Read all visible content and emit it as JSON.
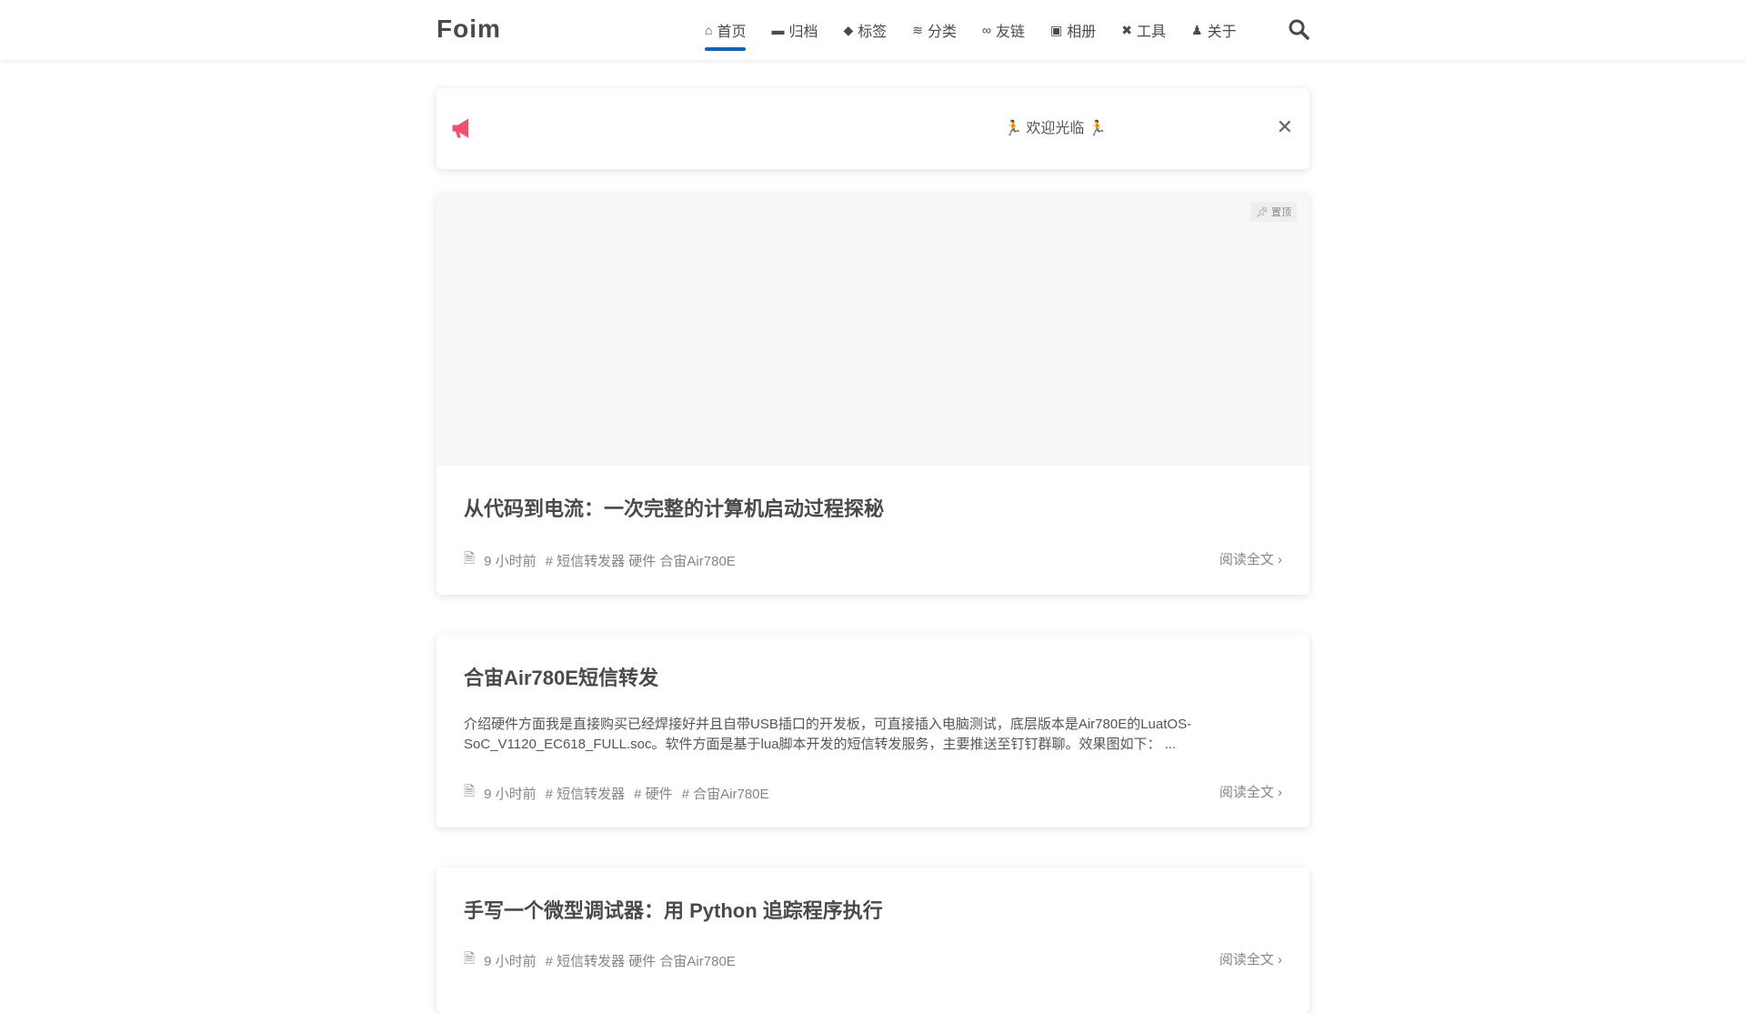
{
  "header": {
    "logo": "Foim",
    "nav": [
      {
        "label": "首页",
        "icon": "home-icon"
      },
      {
        "label": "归档",
        "icon": "archive-icon"
      },
      {
        "label": "标签",
        "icon": "tags-icon"
      },
      {
        "label": "分类",
        "icon": "layers-icon"
      },
      {
        "label": "友链",
        "icon": "link-icon"
      },
      {
        "label": "相册",
        "icon": "image-icon"
      },
      {
        "label": "工具",
        "icon": "tools-icon"
      },
      {
        "label": "关于",
        "icon": "user-graduate-icon"
      }
    ],
    "active": "首页"
  },
  "notice": {
    "message": "🏃 欢迎光临 🏃",
    "close": "✕"
  },
  "colors": {
    "accent": "#0a66c2",
    "megaphone": "#f0506e"
  },
  "posts": [
    {
      "title": "从代码到电流：一次完整的计算机启动过程探秘",
      "pinned": "置顶",
      "time": "9 小时前",
      "tags": "# 短信转发器 硬件 合宙Air780E",
      "more": "阅读全文"
    },
    {
      "title": "合宙Air780E短信转发",
      "excerpt": "介绍硬件方面我是直接购买已经焊接好并且自带USB插口的开发板，可直接插入电脑测试，底层版本是Air780E的LuatOS-SoC_V1120_EC618_FULL.soc。软件方面是基于lua脚本开发的短信转发服务，主要推送至钉钉群聊。效果图如下： ...",
      "time": "9 小时前",
      "tags": [
        "短信转发器",
        "硬件",
        "合宙Air780E"
      ],
      "more": "阅读全文"
    },
    {
      "title": "手写一个微型调试器：用 Python 追踪程序执行",
      "time": "9 小时前",
      "tags": "# 短信转发器 硬件 合宙Air780E",
      "more": "阅读全文"
    }
  ]
}
